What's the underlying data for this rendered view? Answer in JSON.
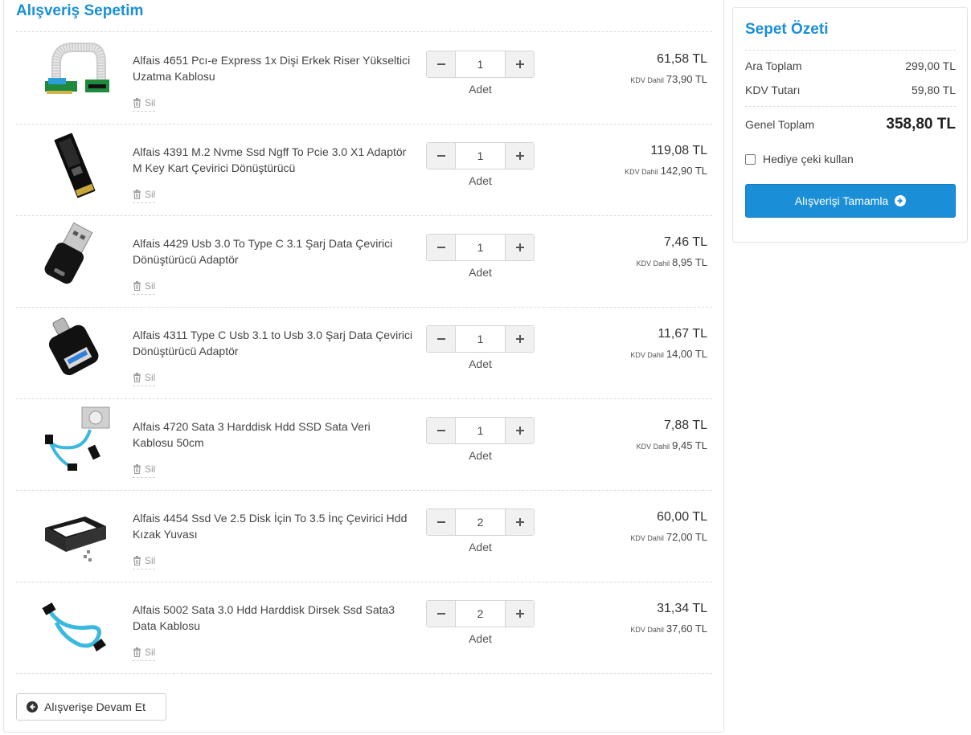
{
  "cart": {
    "title": "Alışveriş Sepetim",
    "remove_label": "Sil",
    "unit_label": "Adet",
    "kdv_label": "KDV Dahil",
    "items": [
      {
        "name": "Alfais 4651 Pcı-e Express 1x Dişi Erkek Riser Yükseltici Uzatma Kablosu",
        "quantity": "1",
        "price": "61,58 TL",
        "price_with_vat": "73,90 TL",
        "image_icon": "pcie-riser-cable-icon"
      },
      {
        "name": "Alfais 4391 M.2 Nvme Ssd Ngff To Pcie 3.0 X1 Adaptör M Key Kart Çevirici Dönüştürücü",
        "quantity": "1",
        "price": "119,08 TL",
        "price_with_vat": "142,90 TL",
        "image_icon": "m2-adapter-card-icon"
      },
      {
        "name": "Alfais 4429 Usb 3.0 To Type C 3.1 Şarj Data Çevirici Dönüştürücü Adaptör",
        "quantity": "1",
        "price": "7,46 TL",
        "price_with_vat": "8,95 TL",
        "image_icon": "usb-to-typec-adapter-icon"
      },
      {
        "name": "Alfais 4311 Type C Usb 3.1 to Usb 3.0 Şarj Data Çevirici Dönüştürücü Adaptör",
        "quantity": "1",
        "price": "11,67 TL",
        "price_with_vat": "14,00 TL",
        "image_icon": "typec-to-usb-adapter-icon"
      },
      {
        "name": "Alfais 4720 Sata 3 Harddisk Hdd SSD Sata Veri Kablosu 50cm",
        "quantity": "1",
        "price": "7,88 TL",
        "price_with_vat": "9,45 TL",
        "image_icon": "sata-cable-icon"
      },
      {
        "name": "Alfais 4454 Ssd Ve 2.5 Disk İçin To 3.5 İnç Çevirici Hdd Kızak Yuvası",
        "quantity": "2",
        "price": "60,00 TL",
        "price_with_vat": "72,00 TL",
        "image_icon": "drive-bracket-icon"
      },
      {
        "name": "Alfais 5002 Sata 3.0 Hdd Harddisk Dirsek Ssd Sata3 Data Kablosu",
        "quantity": "2",
        "price": "31,34 TL",
        "price_with_vat": "37,60 TL",
        "image_icon": "sata-angled-cable-icon"
      }
    ],
    "continue_label": "Alışverişe Devam Et"
  },
  "summary": {
    "title": "Sepet Özeti",
    "subtotal_label": "Ara Toplam",
    "subtotal_value": "299,00 TL",
    "vat_label": "KDV Tutarı",
    "vat_value": "59,80 TL",
    "grand_label": "Genel Toplam",
    "grand_value": "358,80 TL",
    "gift_label": "Hediye çeki kullan",
    "checkout_label": "Alışverişi Tamamla"
  },
  "colors": {
    "accent": "#1a8fd8",
    "cable_blue": "#3ab8e0"
  }
}
